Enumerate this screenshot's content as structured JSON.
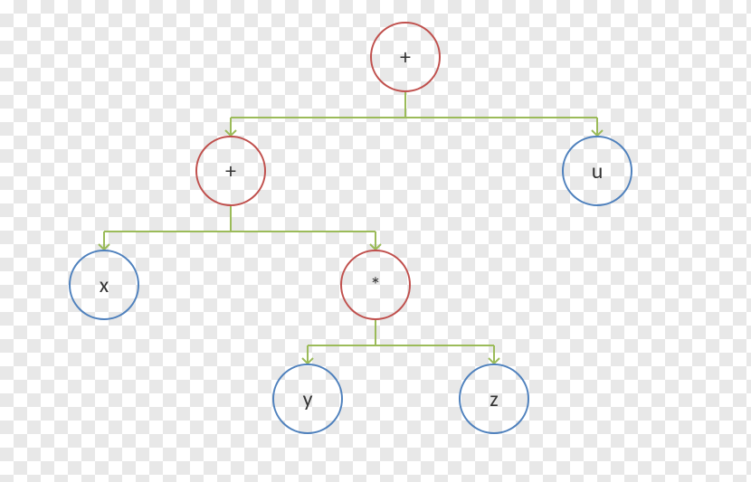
{
  "diagram": {
    "nodes": {
      "root": {
        "label": "+",
        "type": "operator"
      },
      "left": {
        "label": "+",
        "type": "operator"
      },
      "right": {
        "label": "u",
        "type": "leaf"
      },
      "ll": {
        "label": "x",
        "type": "leaf"
      },
      "lr": {
        "label": "*",
        "type": "operator"
      },
      "lrl": {
        "label": "y",
        "type": "leaf"
      },
      "lrr": {
        "label": "z",
        "type": "leaf"
      }
    },
    "colors": {
      "operator": "#c0504d",
      "leaf": "#4f81bd",
      "edge": "#9bbb59"
    },
    "expression": "x + (y * z) + u"
  }
}
